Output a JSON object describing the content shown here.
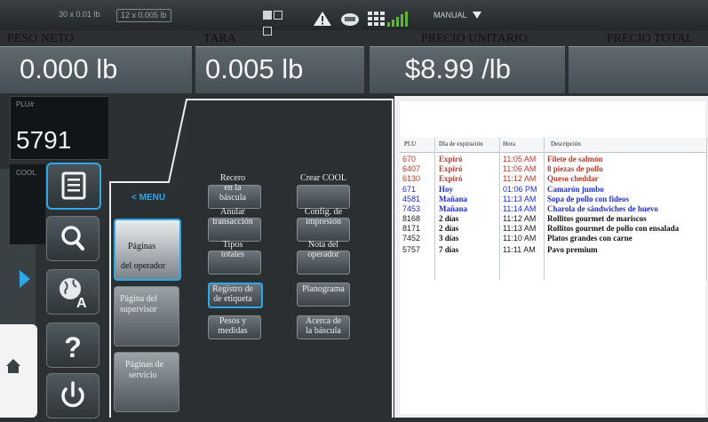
{
  "status_bar": {
    "range1": "30 x 0.01 lb",
    "range2": "12 x 0.005 lb",
    "mode": "MANUAL",
    "icons": [
      "mode-indicator-icon",
      "warning-icon",
      "printer-icon",
      "grid-icon",
      "signal-icon",
      "dropdown-caret-icon"
    ]
  },
  "weights": {
    "peso_neto_label": "PESO NETO",
    "peso_neto_value": "0.000 lb",
    "tara_label": "TARA",
    "tara_value": "0.005 lb",
    "precio_unitario_label": "PRECIO UNITARIO",
    "precio_unitario_value": "$8.99 /lb",
    "precio_total_label": "PRECIO TOTAL"
  },
  "plu": {
    "label": "PLU#",
    "value": "5791"
  },
  "cool_label": "COOL",
  "sidebar_icons": [
    "list-icon",
    "search-icon",
    "globe-language-icon",
    "help-icon",
    "power-icon",
    "home-icon"
  ],
  "menu": {
    "title": "< MENU",
    "categories": [
      {
        "l1": "Páginas",
        "l2": "del operador"
      },
      {
        "l1": "Página del",
        "l2": "supervisor"
      },
      {
        "l1": "Páginas de",
        "l2": "servicio"
      }
    ],
    "buttons": [
      {
        "l1": "Recero",
        "l2": "en la",
        "l3": "báscula"
      },
      {
        "l1": "Crear COOL",
        "l2": "",
        "l3": ""
      },
      {
        "l1": "Anular",
        "l2": "transacción",
        "l3": ""
      },
      {
        "l1": "Config. de",
        "l2": "impresión",
        "l3": ""
      },
      {
        "l1": "Tipos",
        "l2": "totales",
        "l3": ""
      },
      {
        "l1": "Nota del",
        "l2": "operador",
        "l3": ""
      },
      {
        "l1": "Registro de",
        "l2": "de etiqueta",
        "l3": ""
      },
      {
        "l1": "Planograma",
        "l2": "",
        "l3": ""
      },
      {
        "l1": "Pesos y",
        "l2": "medidas",
        "l3": ""
      },
      {
        "l1": "Acerca de",
        "l2": "la báscula",
        "l3": ""
      }
    ]
  },
  "table": {
    "headers": [
      "PLU",
      "Día de expiración",
      "Hora",
      "Descripción"
    ],
    "colors": {
      "expired": "#c0392b",
      "soon": "#1f2fd6",
      "normal": "#111111"
    },
    "rows": [
      {
        "plu": "670",
        "date": "Expiró",
        "time": "11:05 AM",
        "desc": "Filete de salmón",
        "status": "expired"
      },
      {
        "plu": "6407",
        "date": "Expiró",
        "time": "11:06 AM",
        "desc": "8 piezas de pollo",
        "status": "expired"
      },
      {
        "plu": "6130",
        "date": "Expiró",
        "time": "11:12 AM",
        "desc": "Queso cheddar",
        "status": "expired"
      },
      {
        "plu": "671",
        "date": "Hoy",
        "time": "01:06 PM",
        "desc": "Camarón jumbo",
        "status": "soon"
      },
      {
        "plu": "4581",
        "date": "Mañana",
        "time": "11:13 AM",
        "desc": "Sopa de pollo con fideos",
        "status": "soon"
      },
      {
        "plu": "7453",
        "date": "Mañana",
        "time": "11:14 AM",
        "desc": "Charola  de sándwiches de huevo",
        "status": "soon"
      },
      {
        "plu": "8168",
        "date": "2 días",
        "time": "11:12 AM",
        "desc": "Rollitos gourmet de mariscos",
        "status": "normal"
      },
      {
        "plu": "8171",
        "date": "2 días",
        "time": "11:13 AM",
        "desc": "Rollitos gourmet de pollo con ensalada",
        "status": "normal"
      },
      {
        "plu": "7452",
        "date": "3 días",
        "time": "11:10 AM",
        "desc": "Platos grandes con carne",
        "status": "normal"
      },
      {
        "plu": "5757",
        "date": "7 días",
        "time": "11:11 AM",
        "desc": "Pavo premium",
        "status": "normal"
      }
    ]
  }
}
